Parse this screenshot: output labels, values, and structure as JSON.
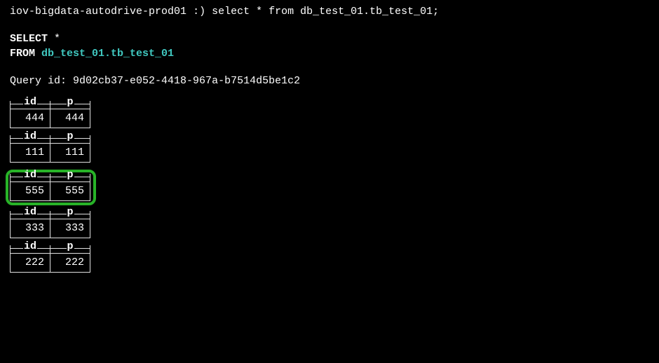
{
  "prompt": {
    "host": "iov-bigdata-autodrive-prod01",
    "smiley": ":)",
    "command": "select * from db_test_01.tb_test_01;"
  },
  "echo": {
    "select": "SELECT",
    "star": "*",
    "from": "FROM",
    "table": "db_test_01.tb_test_01"
  },
  "query_id_label": "Query id:",
  "query_id": "9d02cb37-e052-4418-967a-b7514d5be1c2",
  "columns": {
    "c0": "id",
    "c1": "p"
  },
  "rows": [
    {
      "id": "444",
      "p": "444",
      "highlighted": false
    },
    {
      "id": "111",
      "p": "111",
      "highlighted": false
    },
    {
      "id": "555",
      "p": "555",
      "highlighted": true
    },
    {
      "id": "333",
      "p": "333",
      "highlighted": false
    },
    {
      "id": "222",
      "p": "222",
      "highlighted": false
    }
  ]
}
